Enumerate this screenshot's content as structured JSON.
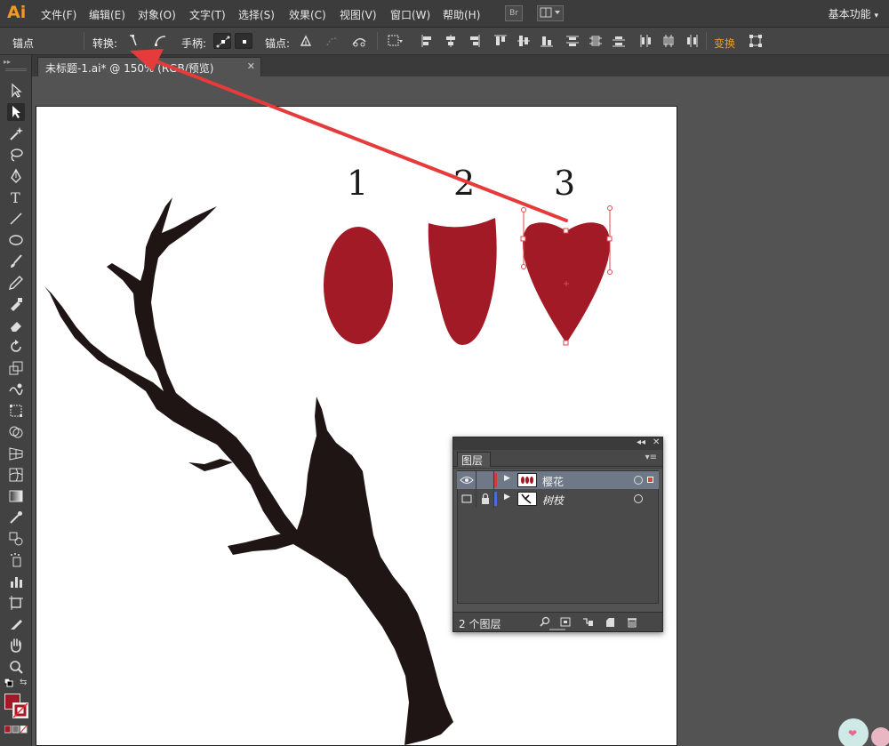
{
  "app": {
    "logo": "Ai",
    "menus": [
      "文件(F)",
      "编辑(E)",
      "对象(O)",
      "文字(T)",
      "选择(S)",
      "效果(C)",
      "视图(V)",
      "窗口(W)",
      "帮助(H)"
    ],
    "bridge_button": "Br",
    "workspace": "基本功能"
  },
  "control": {
    "anchor_label": "锚点",
    "convert_label": "转换:",
    "handles_label": "手柄:",
    "anchors_label": "锚点:",
    "transform_label": "变换"
  },
  "document": {
    "tab_title": "未标题-1.ai* @ 150% (RGB/预览)",
    "close": "✕"
  },
  "artboard": {
    "labels": [
      "1",
      "2",
      "3"
    ]
  },
  "layers_panel": {
    "collapse": "◂◂",
    "close": "✕",
    "tab": "图层",
    "menu": "▾≡",
    "layers": [
      {
        "name": "樱花",
        "color": "#d23c3c",
        "selected": true,
        "visible": true,
        "locked": false
      },
      {
        "name": "树枝",
        "color": "#4f6bd8",
        "selected": false,
        "visible": false,
        "locked": true
      }
    ],
    "count": "2 个图层"
  },
  "colors": {
    "petal": "#a21a25",
    "branch": "#201515",
    "arrow": "#e53b3b",
    "accent": "#f29a1f"
  },
  "icons": {
    "tools": [
      "selection-icon",
      "direct-selection-icon",
      "magic-wand-icon",
      "lasso-icon",
      "pen-icon",
      "type-icon",
      "line-icon",
      "ellipse-icon",
      "paintbrush-icon",
      "pencil-icon",
      "blob-brush-icon",
      "eraser-icon",
      "rotate-icon",
      "scale-icon",
      "warp-icon",
      "free-transform-icon",
      "shape-builder-icon",
      "perspective-grid-icon",
      "mesh-icon",
      "gradient-icon",
      "eyedropper-icon",
      "blend-icon",
      "symbol-sprayer-icon",
      "column-graph-icon",
      "artboard-icon",
      "slice-icon",
      "hand-icon",
      "zoom-icon"
    ]
  }
}
